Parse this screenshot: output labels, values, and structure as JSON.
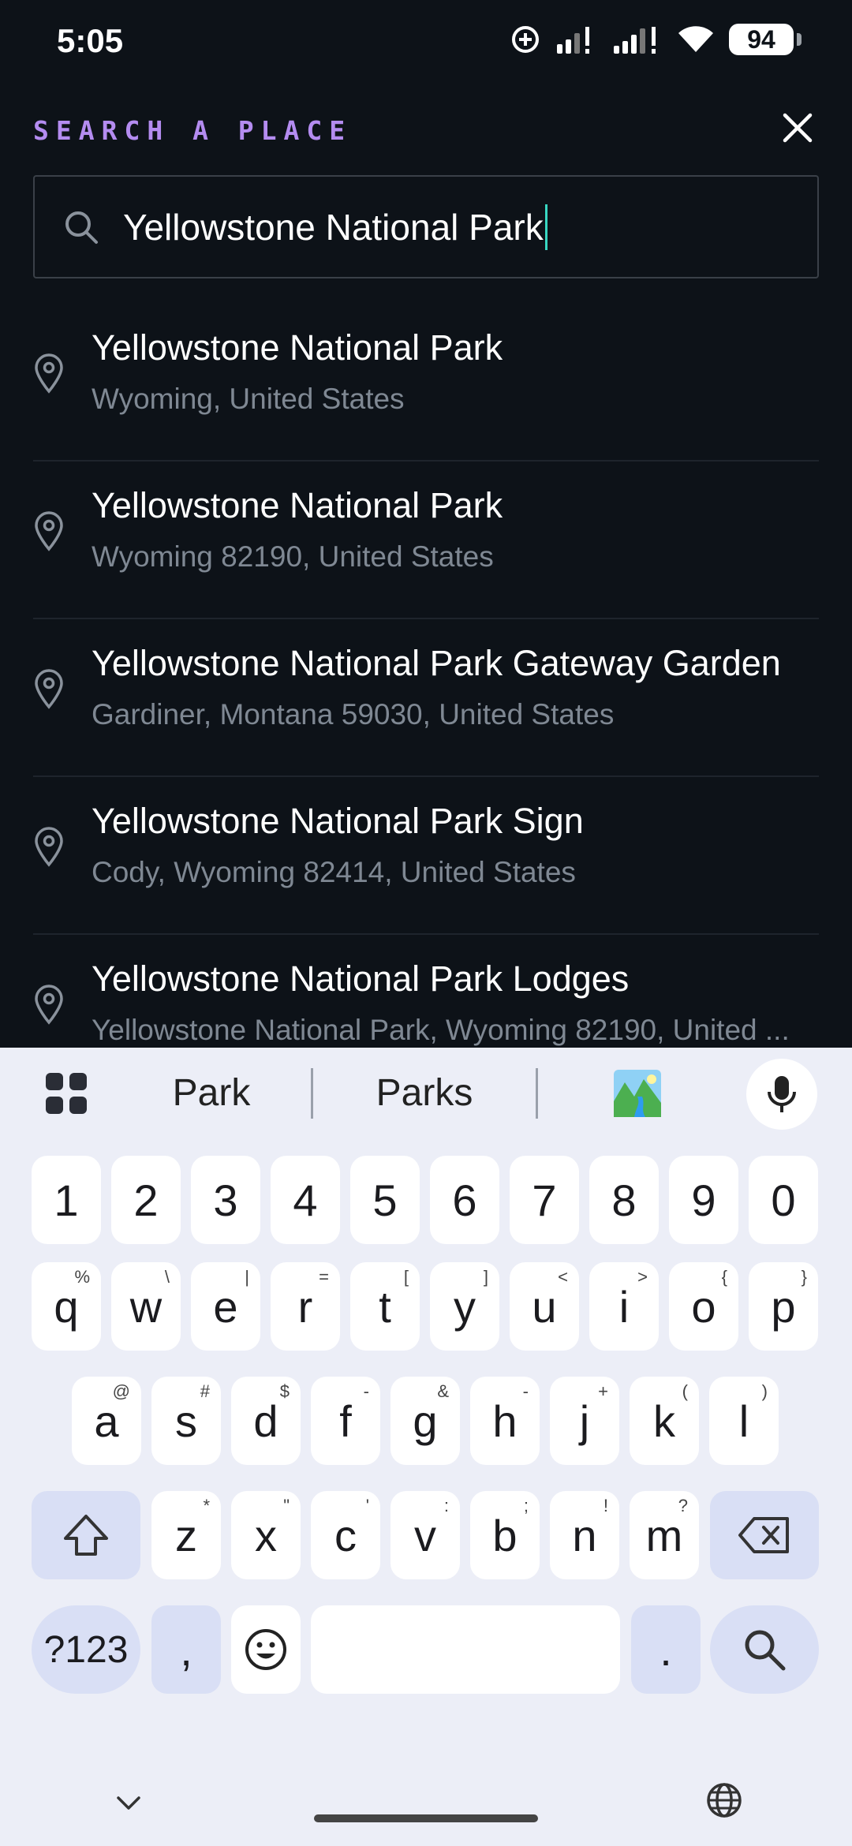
{
  "status_bar": {
    "time": "5:05",
    "battery": "94"
  },
  "header": {
    "title": "SEARCH A PLACE",
    "close_icon": "close-icon"
  },
  "search": {
    "value": "Yellowstone National Park"
  },
  "results": [
    {
      "title": "Yellowstone National Park",
      "subtitle": "Wyoming, United States"
    },
    {
      "title": "Yellowstone National Park",
      "subtitle": "Wyoming 82190, United States"
    },
    {
      "title": "Yellowstone National Park Gateway Garden",
      "subtitle": "Gardiner, Montana 59030, United States"
    },
    {
      "title": "Yellowstone National Park Sign",
      "subtitle": "Cody, Wyoming 82414, United States"
    },
    {
      "title": "Yellowstone National Park Lodges",
      "subtitle": "Yellowstone National Park, Wyoming 82190, United ..."
    }
  ],
  "keyboard": {
    "suggestions": [
      "Park",
      "Parks"
    ],
    "number_row": [
      "1",
      "2",
      "3",
      "4",
      "5",
      "6",
      "7",
      "8",
      "9",
      "0"
    ],
    "row1": [
      [
        "q",
        "%"
      ],
      [
        "w",
        "\\"
      ],
      [
        "e",
        "|"
      ],
      [
        "r",
        "="
      ],
      [
        "t",
        "["
      ],
      [
        "y",
        "]"
      ],
      [
        "u",
        "<"
      ],
      [
        "i",
        ">"
      ],
      [
        "o",
        "{"
      ],
      [
        "p",
        "}"
      ]
    ],
    "row2": [
      [
        "a",
        "@"
      ],
      [
        "s",
        "#"
      ],
      [
        "d",
        "$"
      ],
      [
        "f",
        "-"
      ],
      [
        "g",
        "&"
      ],
      [
        "h",
        "-"
      ],
      [
        "j",
        "+"
      ],
      [
        "k",
        "("
      ],
      [
        "l",
        ")"
      ]
    ],
    "row3": [
      [
        "z",
        "*"
      ],
      [
        "x",
        "\""
      ],
      [
        "c",
        "'"
      ],
      [
        "v",
        ":"
      ],
      [
        "b",
        ";"
      ],
      [
        "n",
        "!"
      ],
      [
        "m",
        "?"
      ]
    ],
    "symbols_label": "?123",
    "comma": ",",
    "period": "."
  },
  "colors": {
    "accent": "#b48cf0",
    "caret": "#38d7c2",
    "background": "#0d1218"
  }
}
